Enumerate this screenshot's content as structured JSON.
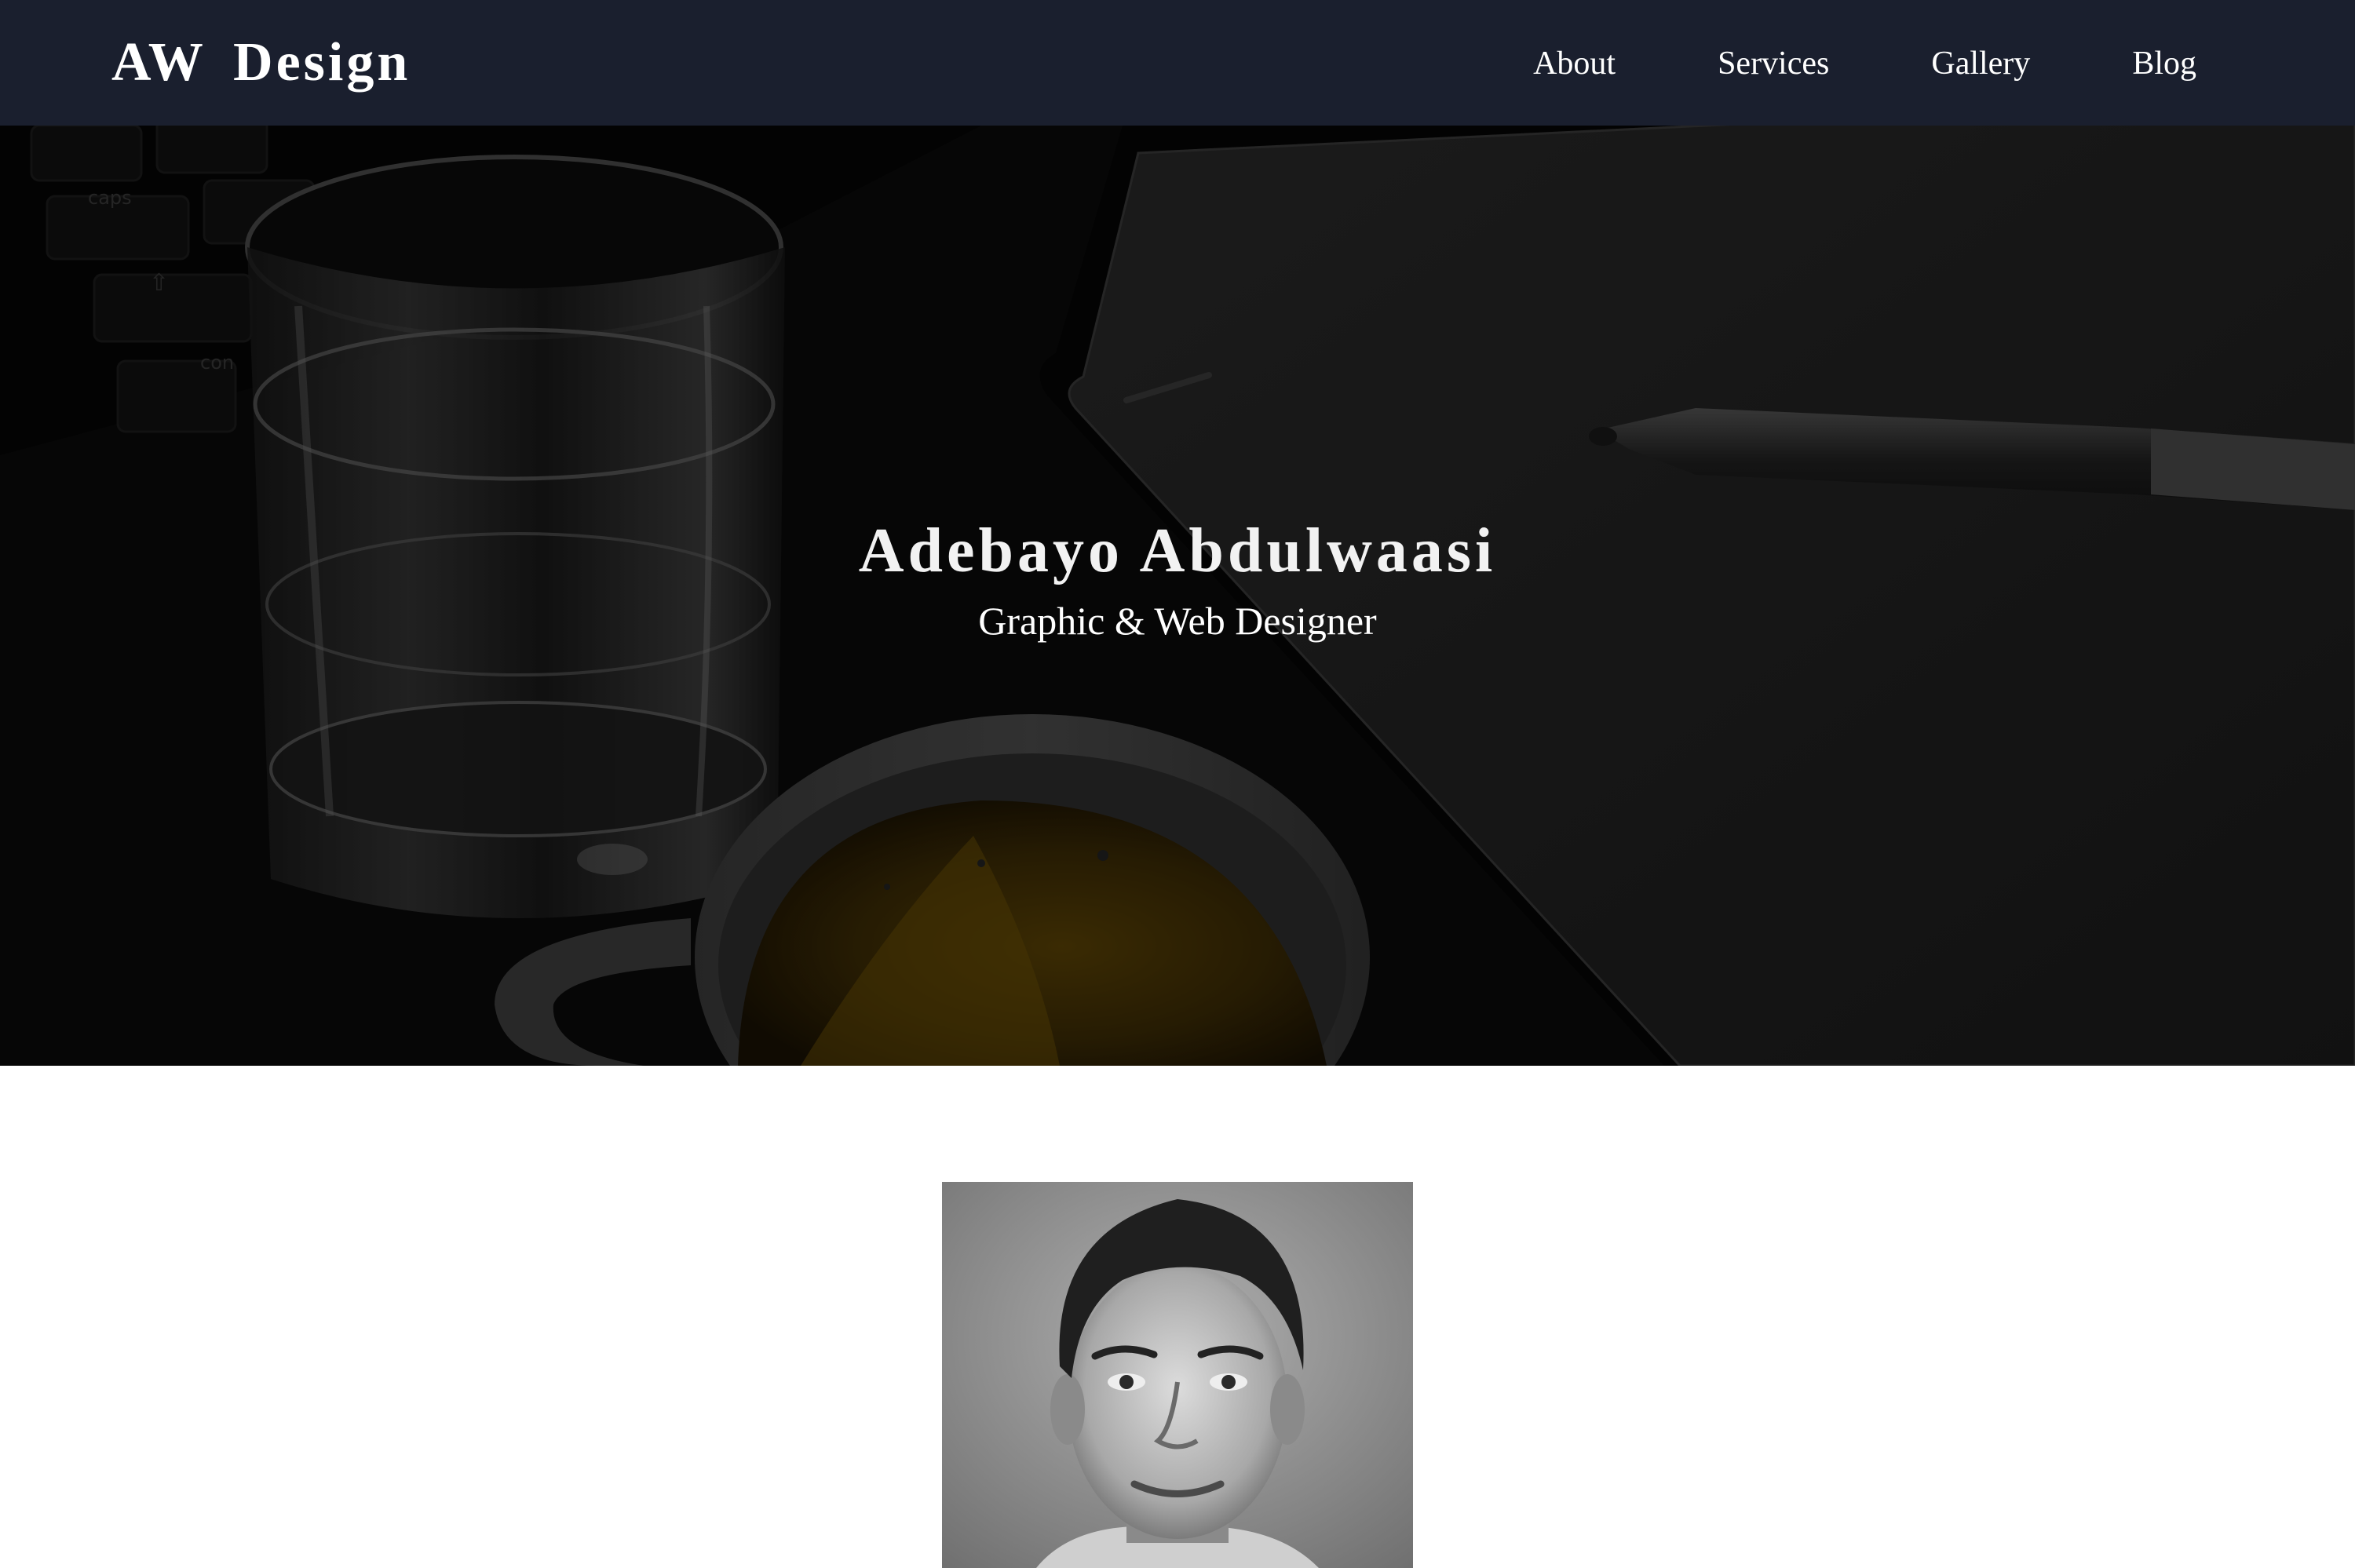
{
  "nav": {
    "brand": "AW Design",
    "links": [
      {
        "label": "About"
      },
      {
        "label": "Services"
      },
      {
        "label": "Gallery"
      },
      {
        "label": "Blog"
      }
    ]
  },
  "hero": {
    "title": "Adebayo Abdulwaasi",
    "subtitle": "Graphic & Web Designer",
    "background_icon": "desk-photo-image"
  },
  "about": {
    "portrait_icon": "portrait-photo-image"
  },
  "colors": {
    "navbar_bg": "#1a1f2e",
    "nav_text": "#ffffff",
    "hero_text": "#f2f2f2",
    "page_bg": "#ffffff"
  }
}
